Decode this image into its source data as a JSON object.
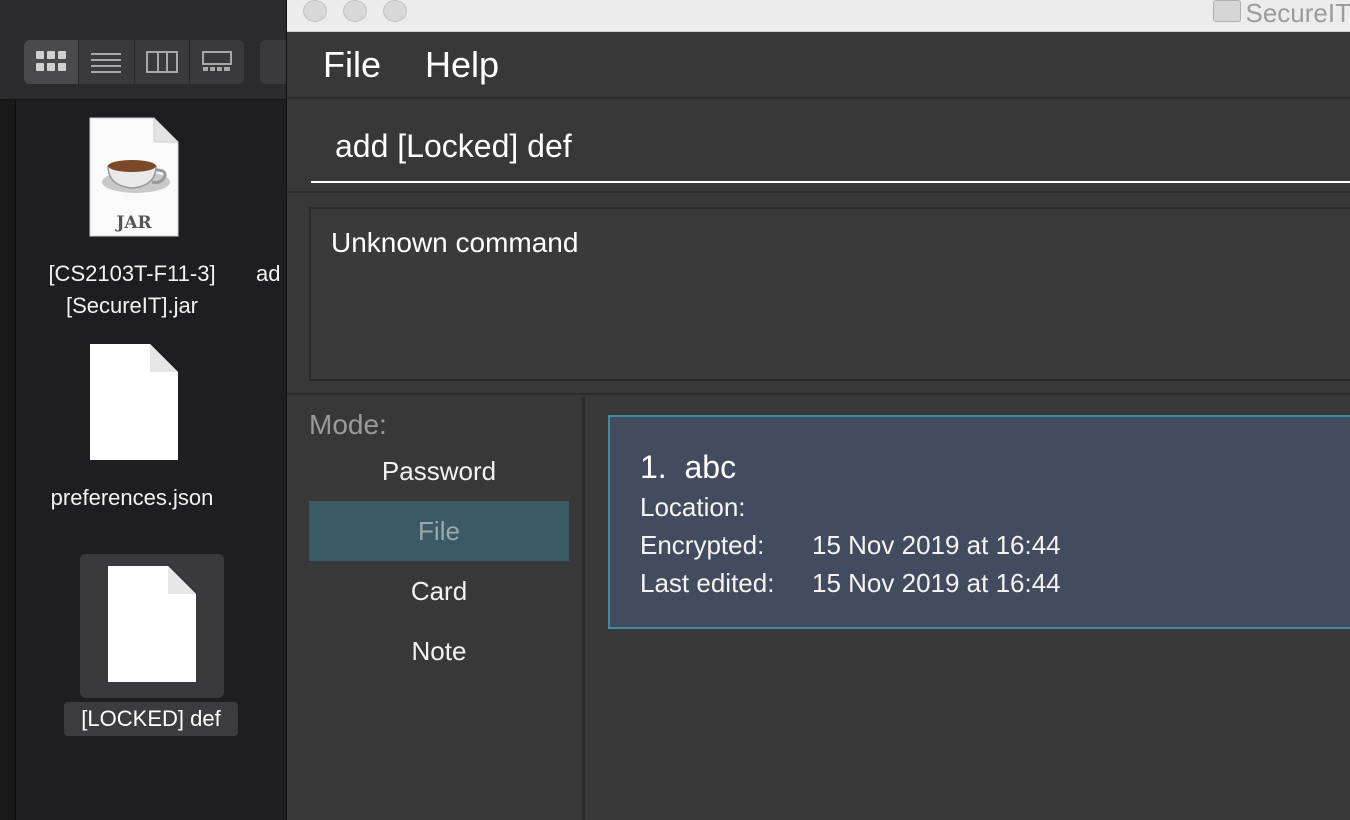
{
  "finder": {
    "files": [
      {
        "name_line1": "[CS2103T-F11-3]",
        "name_line2": "[SecureIT].jar",
        "icon": "jar-file-icon",
        "icon_text": "JAR"
      },
      {
        "name_line1": "preferences.json",
        "icon": "document-icon"
      },
      {
        "name_line1": "[LOCKED] def",
        "icon": "document-icon",
        "selected": true
      }
    ],
    "partial_label": "ad"
  },
  "app": {
    "title": "SecureIT",
    "menu": [
      "File",
      "Help"
    ],
    "command_value": "add [Locked] def",
    "result_text": "Unknown command",
    "mode": {
      "title": "Mode:",
      "items": [
        "Password",
        "File",
        "Card",
        "Note"
      ],
      "selected": "File"
    },
    "files": [
      {
        "index": "1.",
        "name": "abc",
        "location_label": "Location:",
        "location": "",
        "encrypted_label": "Encrypted:",
        "encrypted": "15 Nov 2019 at 16:44",
        "edited_label": "Last edited:",
        "edited": "15 Nov 2019 at 16:44"
      }
    ]
  },
  "colors": {
    "selected_mode_bg": "#3c5966",
    "card_bg": "#434c5e",
    "card_border": "#3b8da1"
  }
}
